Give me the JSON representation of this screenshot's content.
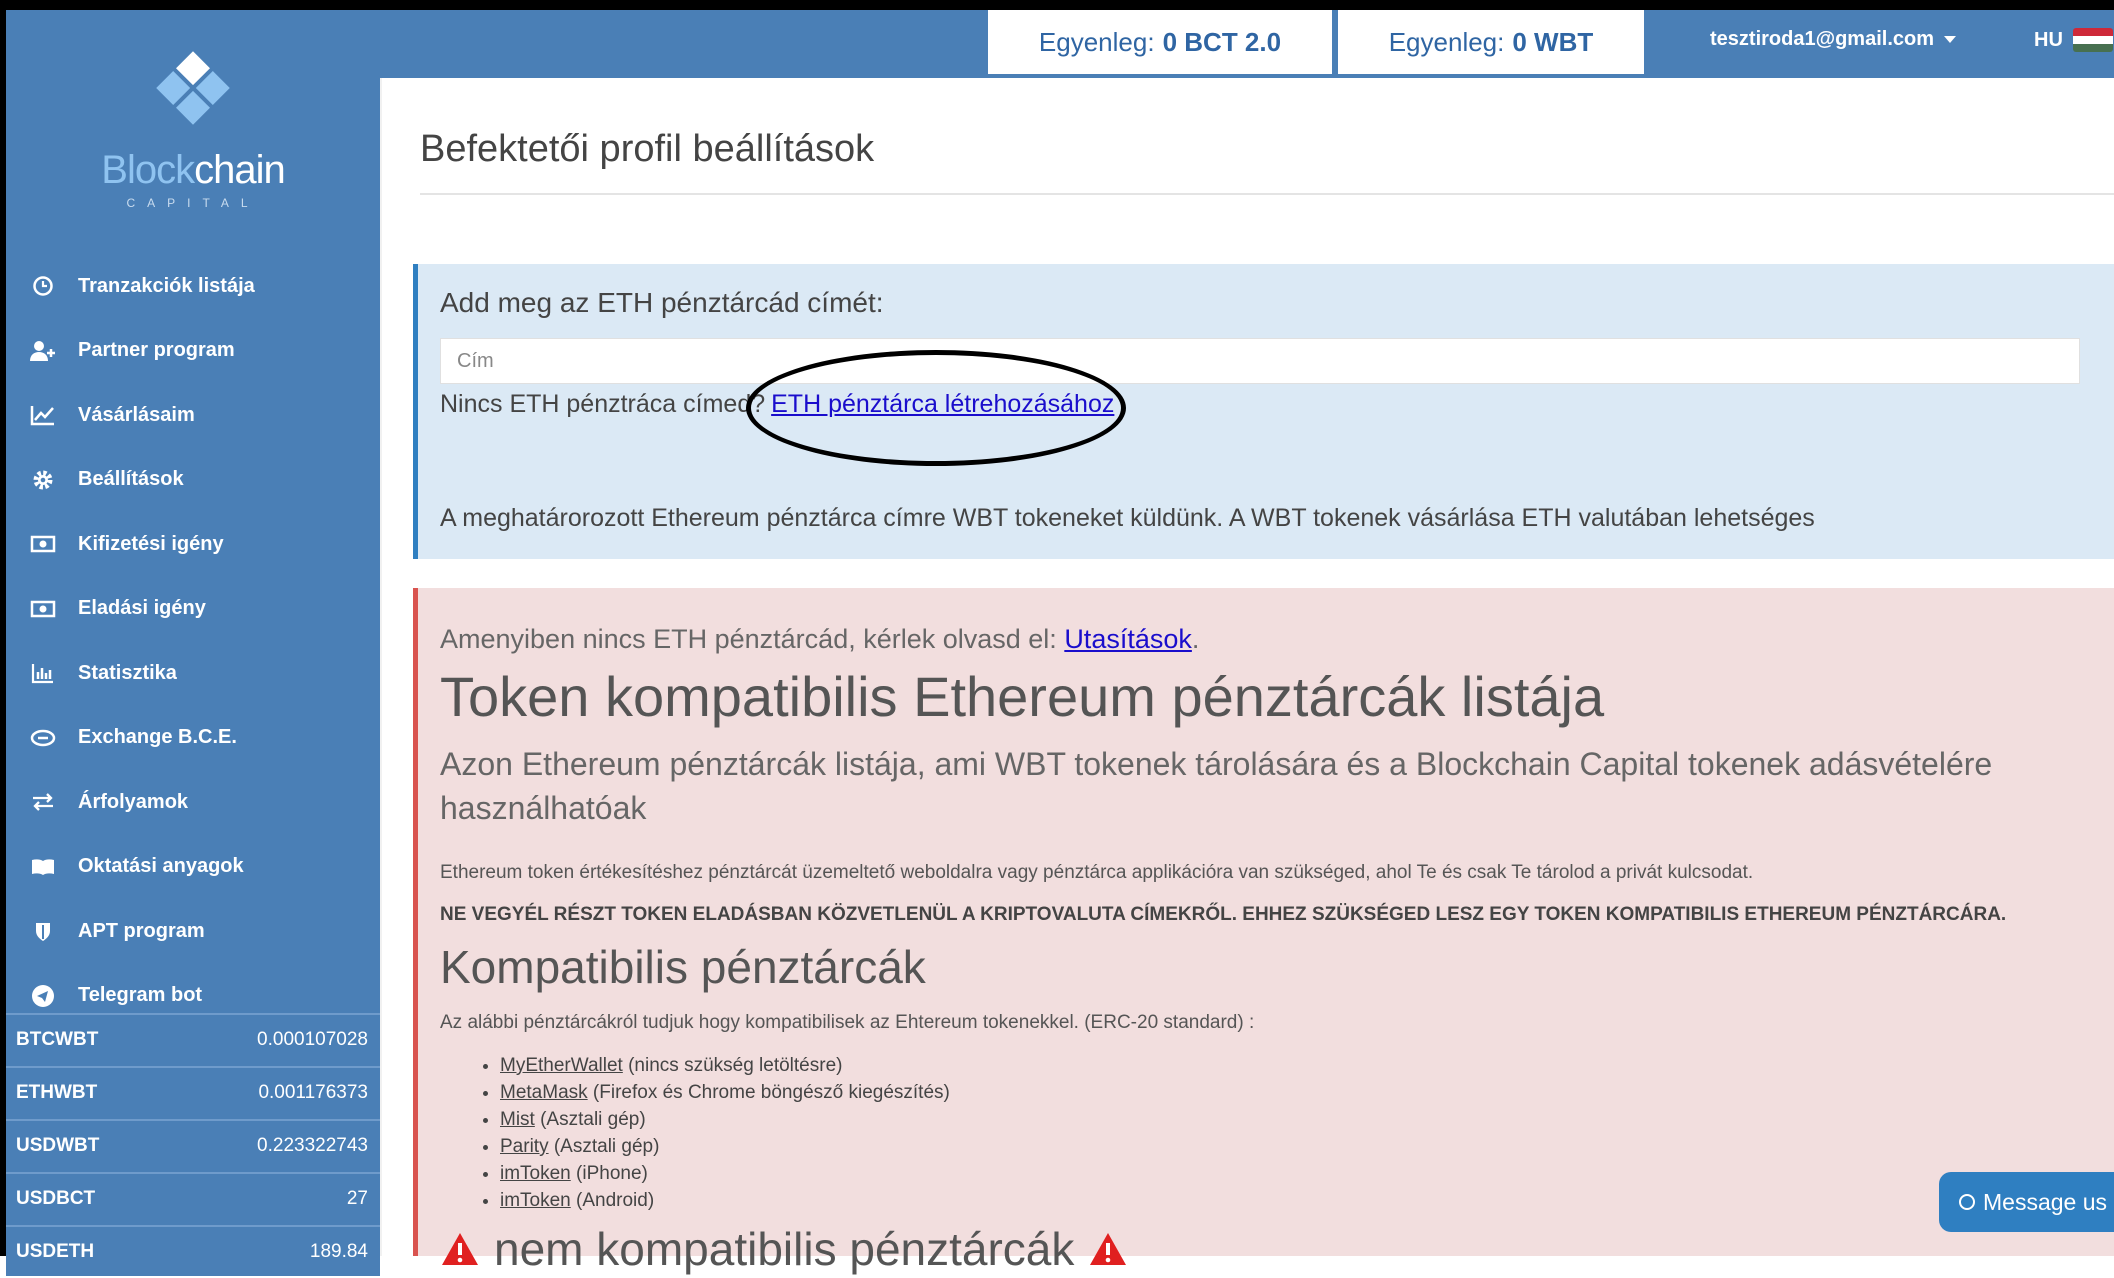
{
  "header": {
    "balance1_label": "Egyenleg:",
    "balance1_value": "0 BCT 2.0",
    "balance2_label": "Egyenleg:",
    "balance2_value": "0 WBT",
    "user_email": "tesztiroda1@gmail.com",
    "language": "HU"
  },
  "brand": {
    "name_light": "Block",
    "name_bold": "chain",
    "subtitle": "CAPITAL"
  },
  "sidebar": {
    "items": [
      {
        "label": "Tranzakciók listája",
        "icon": "clock-icon"
      },
      {
        "label": "Partner program",
        "icon": "add-user-icon"
      },
      {
        "label": "Vásárlásaim",
        "icon": "line-chart-icon"
      },
      {
        "label": "Beállítások",
        "icon": "gear-icon"
      },
      {
        "label": "Kifizetési igény",
        "icon": "money-icon"
      },
      {
        "label": "Eladási igény",
        "icon": "money-icon"
      },
      {
        "label": "Statisztika",
        "icon": "bar-chart-icon"
      },
      {
        "label": "Exchange B.C.E.",
        "icon": "exchange-icon"
      },
      {
        "label": "Árfolyamok",
        "icon": "arrows-icon"
      },
      {
        "label": "Oktatási anyagok",
        "icon": "book-icon"
      },
      {
        "label": "APT program",
        "icon": "shield-icon"
      },
      {
        "label": "Telegram bot",
        "icon": "telegram-icon"
      }
    ],
    "rates": [
      {
        "pair": "BTCWBT",
        "value": "0.000107028"
      },
      {
        "pair": "ETHWBT",
        "value": "0.001176373"
      },
      {
        "pair": "USDWBT",
        "value": "0.223322743"
      },
      {
        "pair": "USDBCT",
        "value": "27"
      },
      {
        "pair": "USDETH",
        "value": "189.84"
      }
    ]
  },
  "main": {
    "title": "Befektetői profil beállítások",
    "eth_label": "Add meg az ETH pénztárcád címét:",
    "address_placeholder": "Cím",
    "no_address_text": "Nincs ETH pénztráca címed?",
    "create_wallet_link": "ETH pénztárca létrehozásához",
    "info_text": "A meghatárorozott Ethereum pénztárca címre WBT tokeneket küldünk. A WBT tokenek vásárlása ETH valutában lehetséges",
    "intro_text": "Amenyiben nincs ETH pénztárcád, kérlek olvasd el:",
    "instructions_link": "Utasítások",
    "intro_end": ".",
    "heading1": "Token kompatibilis Ethereum pénztárcák listája",
    "subheading": "Azon Ethereum pénztárcák listája, ami WBT tokenek tárolására és a Blockchain Capital tokenek adásvételére használhatóak",
    "paragraph": "Ethereum token értékesítéshez pénztárcát üzemeltető weboldalra vagy pénztárca applikációra van szükséged, ahol Te és csak Te tárolod a privát kulcsodat.",
    "warning": "NE VEGYÉL RÉSZT TOKEN ELADÁSBAN KÖZVETLENÜL A KRIPTOVALUTA CÍMEKRŐL. EHHEZ SZÜKSÉGED LESZ EGY TOKEN KOMPATIBILIS ETHEREUM PÉNZTÁRCÁRA.",
    "heading2": "Kompatibilis pénztárcák",
    "compat_intro": "Az alábbi pénztárcákról tudjuk hogy kompatibilisek az Ehtereum tokenekkel. (ERC-20 standard) :",
    "wallets": [
      {
        "name": "MyEtherWallet",
        "note": "(nincs szükség letöltésre)"
      },
      {
        "name": "MetaMask",
        "note": "(Firefox és Chrome böngésző kiegészítés)"
      },
      {
        "name": "Mist",
        "note": "(Asztali gép)"
      },
      {
        "name": "Parity",
        "note": "(Asztali gép)"
      },
      {
        "name": "imToken",
        "note": "(iPhone)"
      },
      {
        "name": "imToken",
        "note": "(Android)"
      }
    ],
    "heading3": "nem kompatibilis pénztárcák"
  },
  "chat": {
    "label": "Message us"
  },
  "colors": {
    "sidebar": "#4a7fb6",
    "info_panel": "#dbe9f5",
    "warning_panel": "#f2dede",
    "link": "#1a0dcc"
  }
}
